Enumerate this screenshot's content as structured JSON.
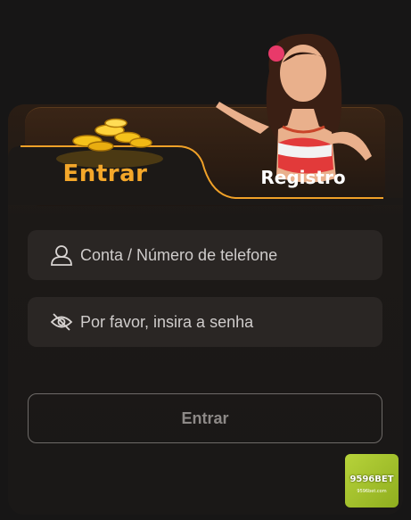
{
  "tabs": {
    "active_label": "Entrar",
    "inactive_label": "Registro"
  },
  "form": {
    "account_placeholder": "Conta / Número de telefone",
    "password_placeholder": "Por favor, insira a senha",
    "submit_label": "Entrar"
  },
  "brand": {
    "name": "9596BET",
    "url": "9596bet.com"
  },
  "icons": {
    "account": "user-icon",
    "password": "eye-off-icon",
    "coins": "gold-coins-icon",
    "mascot": "mascot-image"
  },
  "colors": {
    "accent": "#f4a72a",
    "background": "#171616",
    "field": "#2a2624"
  }
}
